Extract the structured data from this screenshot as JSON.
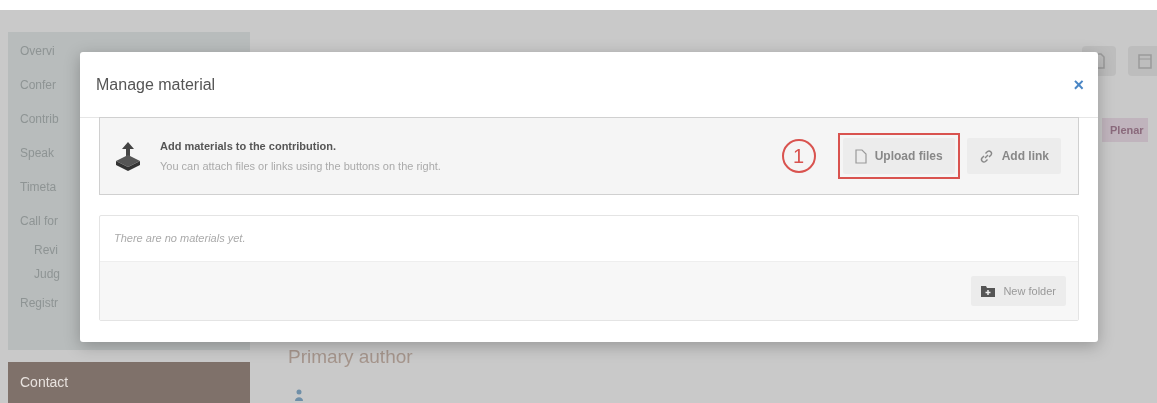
{
  "background_page": {
    "sidebar": {
      "items": [
        {
          "label": "Overvi"
        },
        {
          "label": "Confer"
        },
        {
          "label": "Contrib"
        },
        {
          "label": "Speak"
        },
        {
          "label": "Timeta"
        },
        {
          "label": "Call for"
        },
        {
          "label": "Revi"
        },
        {
          "label": "Judg"
        },
        {
          "label": "Registr"
        }
      ],
      "contact": "Contact"
    },
    "tag": "Plenar",
    "section_heading": "Primary author"
  },
  "modal": {
    "title": "Manage material",
    "close": "×",
    "info_title": "Add materials to the contribution.",
    "info_text": "You can attach files or links using the buttons on the right.",
    "step_marker": "1",
    "buttons": [
      {
        "label": "Upload files",
        "kind": "file",
        "highlighted": true
      },
      {
        "label": "Add link",
        "kind": "link",
        "highlighted": false
      }
    ],
    "empty_text": "There are no materials yet.",
    "folder_button": "New folder"
  }
}
